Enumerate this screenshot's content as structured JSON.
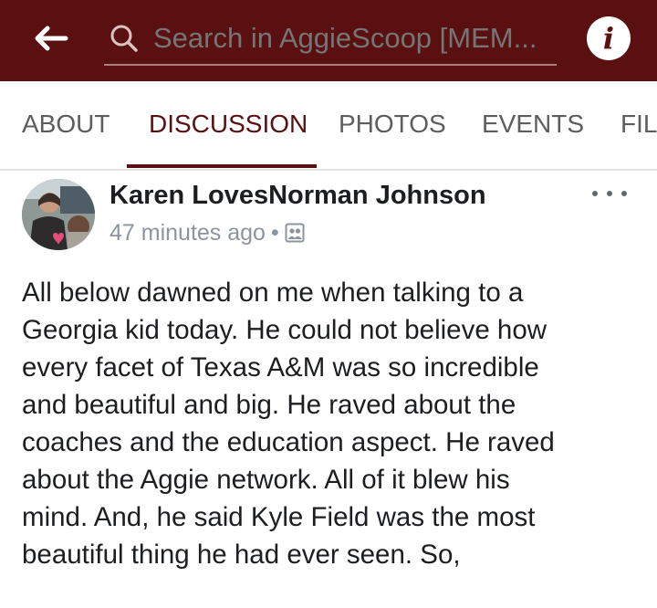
{
  "header": {
    "search_placeholder": "Search in AggieScoop [MEM...",
    "info_glyph": "i",
    "background_color": "#5a1010"
  },
  "tabs": [
    {
      "label": "ABOUT",
      "active": false
    },
    {
      "label": "DISCUSSION",
      "active": true
    },
    {
      "label": "PHOTOS",
      "active": false
    },
    {
      "label": "EVENTS",
      "active": false
    },
    {
      "label": "FIL",
      "active": false
    }
  ],
  "post": {
    "author": "Karen LovesNorman Johnson",
    "timestamp": "47 minutes ago",
    "separator": "•",
    "audience_icon": "group-audience-icon",
    "lines": [
      "All below dawned on me when talking to a",
      "Georgia kid today. He could not believe how",
      "every facet of Texas A&M was so incredible",
      "and beautiful and big. He raved about the",
      "coaches and the education aspect. He raved",
      "about the Aggie network. All of it blew his",
      "mind. And, he said Kyle Field was the most",
      "beautiful thing he had ever seen. So,"
    ]
  }
}
